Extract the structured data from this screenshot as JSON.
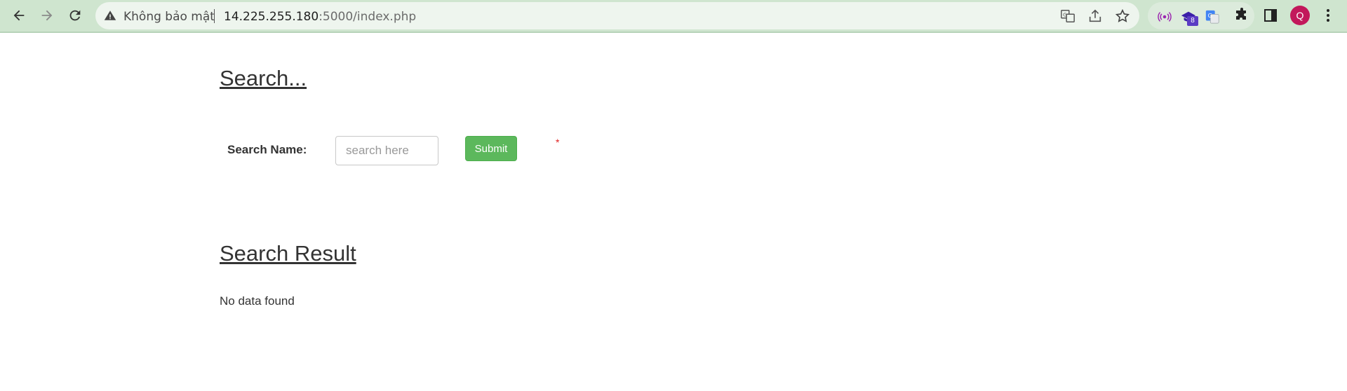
{
  "browser": {
    "security_label": "Không bảo mật",
    "url_host": "14.225.255.180",
    "url_rest": ":5000/index.php",
    "extension_badge": "8",
    "avatar_letter": "Q",
    "colors": {
      "toolbar": "#cfe5cf",
      "avatar": "#c2185b",
      "badge": "#5b3cc4"
    }
  },
  "search": {
    "heading": "Search...",
    "label": "Search Name:",
    "placeholder": "search here",
    "value": "",
    "submit_label": "Submit",
    "required_mark": "*"
  },
  "results": {
    "heading": "Search Result",
    "message": "No data found"
  },
  "colors": {
    "submit": "#5cb85c",
    "required": "#e02020"
  }
}
